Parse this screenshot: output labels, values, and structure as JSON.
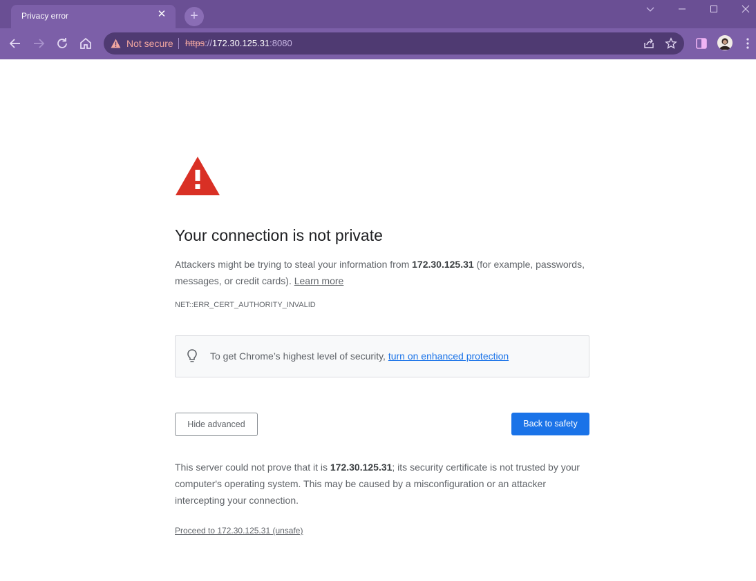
{
  "browser": {
    "tab": {
      "title": "Privacy error",
      "close_glyph": "✕"
    },
    "new_tab_glyph": "+",
    "omnibox": {
      "security_label": "Not secure",
      "url_scheme": "https",
      "url_separator": "://",
      "url_host": "172.30.125.31",
      "url_port": ":8080"
    },
    "colors": {
      "frame": "#6a4f94",
      "toolbar": "#7c5fa8",
      "omnibox": "#4f3a72",
      "warning_text": "#f2a6a0"
    }
  },
  "interstitial": {
    "heading": "Your connection is not private",
    "desc_part1": "Attackers might be trying to steal your information from ",
    "host": "172.30.125.31",
    "desc_part2": " (for example, passwords, messages, or credit cards). ",
    "learn_more": "Learn more",
    "error_code": "NET::ERR_CERT_AUTHORITY_INVALID",
    "info_text": "To get Chrome’s highest level of security, ",
    "info_link": "turn on enhanced protection",
    "hide_advanced": "Hide advanced",
    "back_to_safety": "Back to safety",
    "advanced_part1": "This server could not prove that it is ",
    "advanced_part2": "; its security certificate is not trusted by your computer's operating system. This may be caused by a misconfiguration or an attacker intercepting your connection.",
    "proceed_link": "Proceed to 172.30.125.31 (unsafe)",
    "colors": {
      "warning_icon": "#d93025",
      "primary_button": "#1a73e8",
      "link": "#1a73e8"
    }
  },
  "icons": {
    "window_controls": [
      "chevron-down-icon",
      "minimize-icon",
      "maximize-icon",
      "close-icon"
    ],
    "toolbar": [
      "back-arrow-icon",
      "forward-arrow-icon",
      "reload-icon",
      "home-icon",
      "share-icon",
      "star-icon",
      "side-panel-icon",
      "avatar",
      "kebab-menu-icon"
    ],
    "content": [
      "warning-triangle-icon",
      "lightbulb-icon"
    ]
  }
}
